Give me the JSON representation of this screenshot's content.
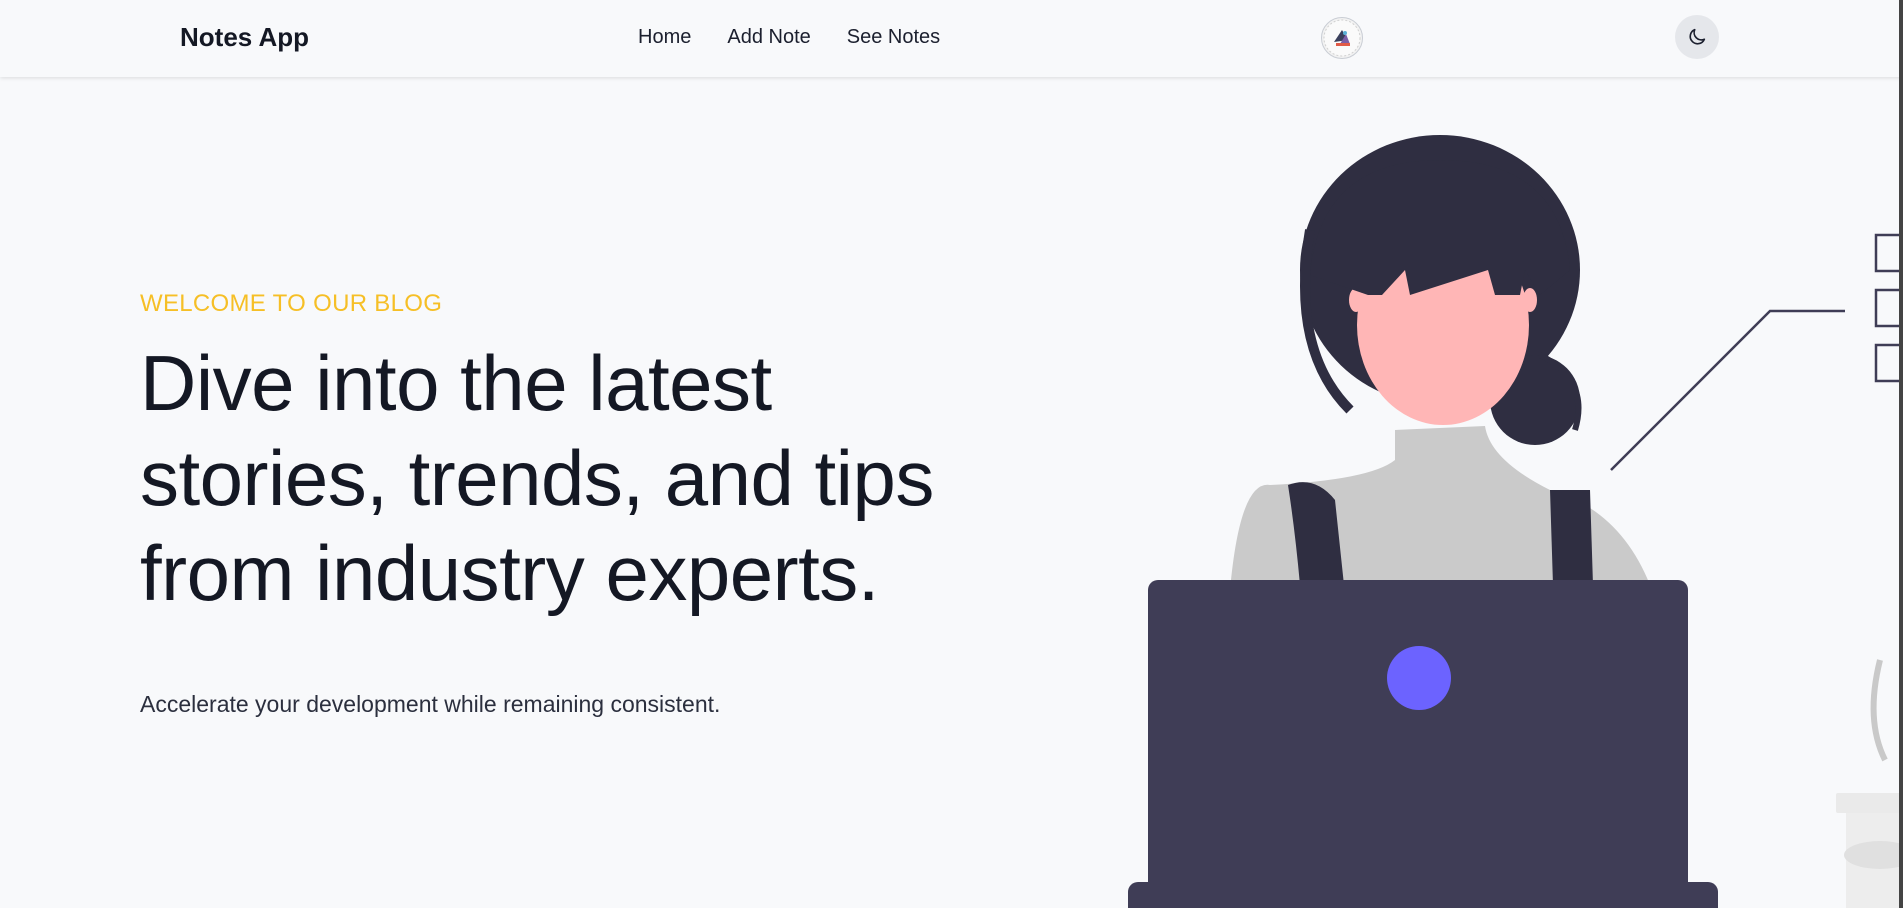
{
  "navbar": {
    "brand": "Notes App",
    "links": [
      {
        "label": "Home"
      },
      {
        "label": "Add Note"
      },
      {
        "label": "See Notes"
      }
    ],
    "avatar_icon": "user-avatar",
    "theme_toggle_icon": "moon-icon"
  },
  "hero": {
    "eyebrow": "WELCOME TO OUR BLOG",
    "headline": "Dive into the latest stories, trends, and tips from industry experts.",
    "subtext": "Accelerate your development while remaining consistent."
  },
  "colors": {
    "accent": "#f6bf26",
    "laptop": "#3f3d56",
    "laptop_logo": "#6c63ff",
    "hair": "#2f2e41",
    "skin": "#ffb6b6",
    "shirt": "#cacaca",
    "background": "#f8f9fb"
  }
}
